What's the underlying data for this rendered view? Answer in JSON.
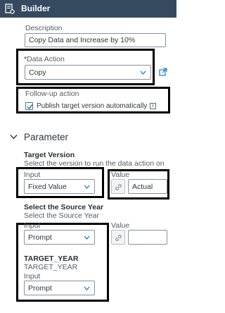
{
  "header": {
    "title": "Builder",
    "background": "#354a5f"
  },
  "general": {
    "description_label": "Description",
    "description_value": "Copy Data and Increase by 10%",
    "data_action_required": "*",
    "data_action_label": "Data Action",
    "data_action_value": "Copy",
    "followup_label": "Follow-up action",
    "publish_label": "Publish target version automatically",
    "publish_checked": true
  },
  "parameter": {
    "section_title": "Parameter",
    "target_version": {
      "title": "Target Version",
      "help": "Select the version to run the data action on",
      "input_label": "Input",
      "input_value": "Fixed Value",
      "value_label": "Value",
      "value_value": "Actual"
    },
    "source_year": {
      "title": "Select the Source Year",
      "help": "Select the Source Year",
      "input_label": "Input",
      "input_value": "Prompt",
      "value_label": "Value",
      "value_value": ""
    },
    "target_year": {
      "title": "TARGET_YEAR",
      "subtitle": "TARGET_YEAR",
      "input_label": "Input",
      "input_value": "Prompt"
    }
  },
  "icons": {
    "header": "document-settings-icon",
    "open_external": "open-external-icon",
    "info": "info-icon",
    "chevron": "chevron-down-icon",
    "link": "link-icon"
  },
  "colors": {
    "highlight_border": "#000000",
    "link_blue": "#0a6ed1",
    "required": "#bb0000"
  }
}
